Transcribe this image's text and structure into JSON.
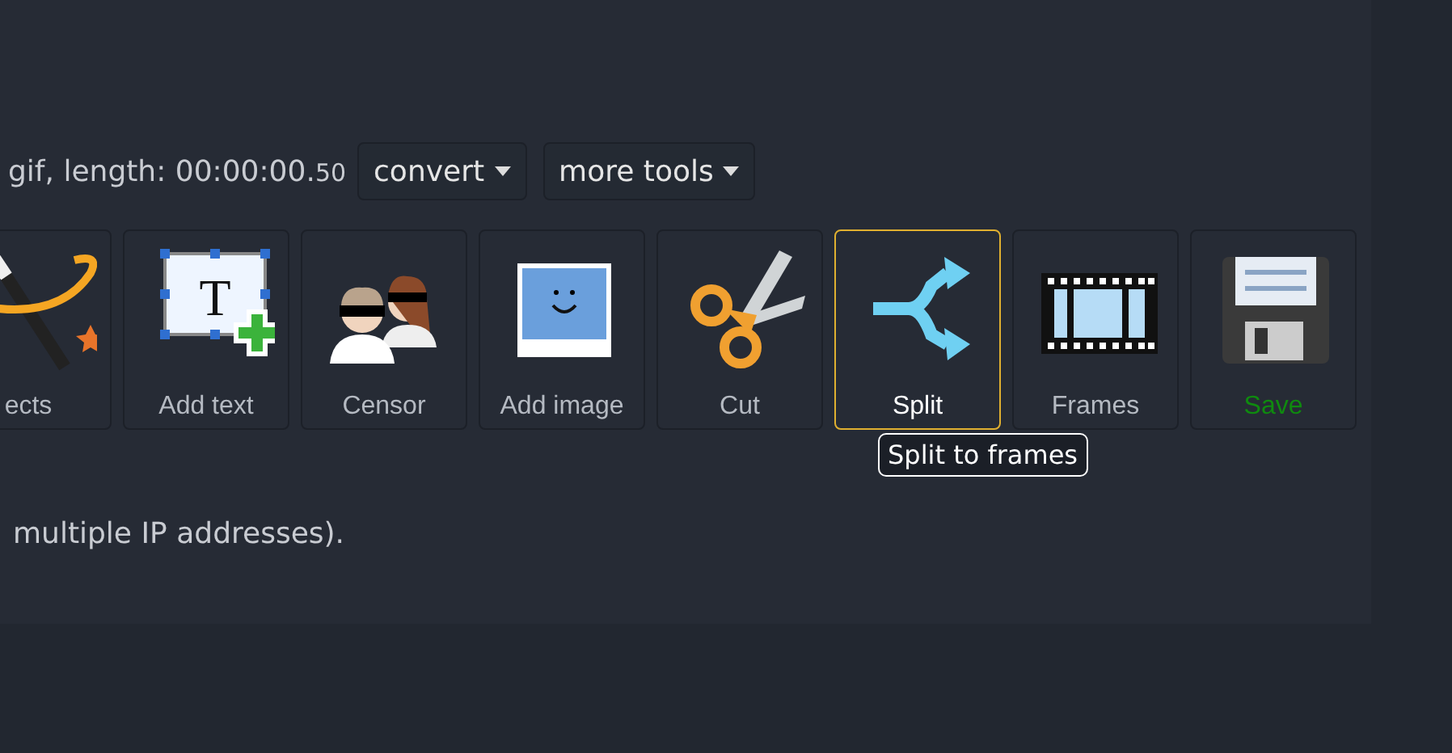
{
  "info": {
    "text": "gif, length: 00:00:00.",
    "small": "50"
  },
  "dropdowns": [
    {
      "label": "convert"
    },
    {
      "label": "more tools"
    }
  ],
  "tools": [
    {
      "kind": "effects",
      "label": "ects",
      "selected": false
    },
    {
      "kind": "text",
      "label": "Add text",
      "glyph": "T",
      "selected": false
    },
    {
      "kind": "censor",
      "label": "Censor",
      "selected": false
    },
    {
      "kind": "image",
      "label": "Add image",
      "selected": false
    },
    {
      "kind": "cut",
      "label": "Cut",
      "selected": false
    },
    {
      "kind": "split",
      "label": "Split",
      "selected": true
    },
    {
      "kind": "frames",
      "label": "Frames",
      "selected": false
    },
    {
      "kind": "save",
      "label": "Save",
      "selected": false
    }
  ],
  "tooltip": "Split to frames",
  "note": "multiple IP addresses)."
}
